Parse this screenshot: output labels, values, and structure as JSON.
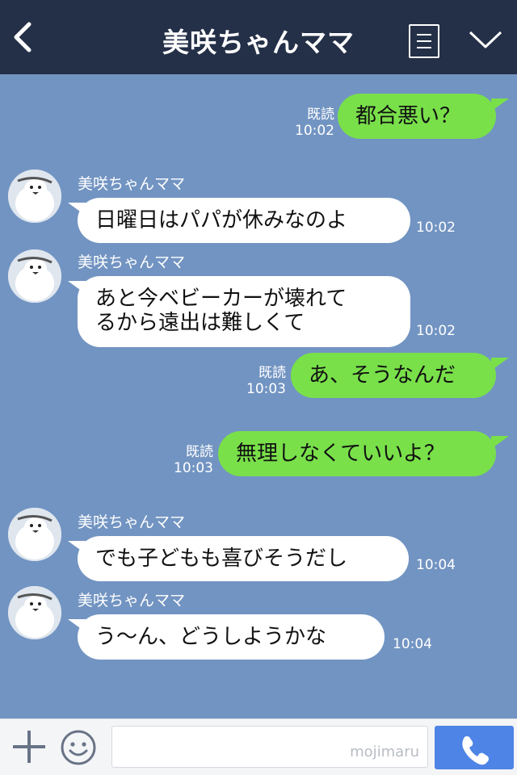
{
  "header": {
    "title": "美咲ちゃんママ"
  },
  "icons": {
    "back": "back-chevron-icon",
    "menu": "menu-lines-icon",
    "collapse": "chevron-down-icon",
    "add": "plus-icon",
    "emoji": "smiley-icon",
    "call": "phone-icon"
  },
  "colors": {
    "header_bg": "#243048",
    "chat_bg": "#7294c2",
    "my_bubble": "#79e04a",
    "their_bubble": "#ffffff",
    "call_button": "#4d84e6"
  },
  "messages": [
    {
      "from": "me",
      "text": "都合悪い？",
      "read": "既読",
      "time": "10:02"
    },
    {
      "from": "other",
      "sender": "美咲ちゃんママ",
      "text": "日曜日はパパが休みなのよ",
      "time": "10:02"
    },
    {
      "from": "other",
      "sender": "美咲ちゃんママ",
      "text_lines": [
        "あと今ベビーカーが壊れて",
        "るから遠出は難しくて"
      ],
      "time": "10:02"
    },
    {
      "from": "me",
      "text": "あ、そうなんだ",
      "read": "既読",
      "time": "10:03"
    },
    {
      "from": "me",
      "text": "無理しなくていいよ？",
      "read": "既読",
      "time": "10:03"
    },
    {
      "from": "other",
      "sender": "美咲ちゃんママ",
      "text": "でも子どもも喜びそうだし",
      "time": "10:04"
    },
    {
      "from": "other",
      "sender": "美咲ちゃんママ",
      "text": "う〜ん、どうしようかな",
      "time": "10:04"
    }
  ],
  "footer": {
    "watermark": "mojimaru"
  }
}
